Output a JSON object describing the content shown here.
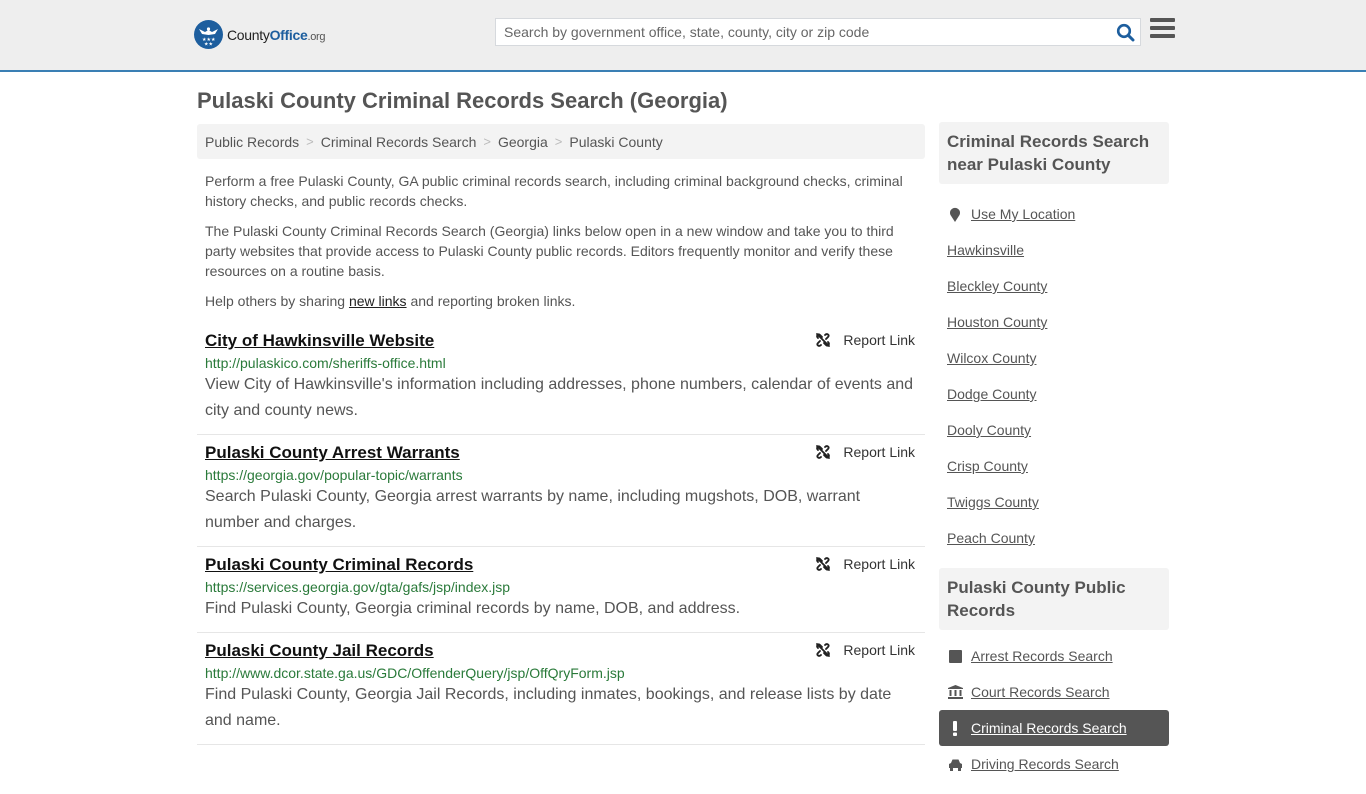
{
  "header": {
    "logo": {
      "county": "County",
      "office": "Office",
      "org": ".org"
    },
    "search_placeholder": "Search by government office, state, county, city or zip code",
    "search_value": ""
  },
  "page_title": "Pulaski County Criminal Records Search (Georgia)",
  "breadcrumb": [
    {
      "label": "Public Records"
    },
    {
      "label": "Criminal Records Search"
    },
    {
      "label": "Georgia"
    },
    {
      "label": "Pulaski County"
    }
  ],
  "breadcrumb_separator": ">",
  "intro": {
    "p1": "Perform a free Pulaski County, GA public criminal records search, including criminal background checks, criminal history checks, and public records checks.",
    "p2": "The Pulaski County Criminal Records Search (Georgia) links below open in a new window and take you to third party websites that provide access to Pulaski County public records. Editors frequently monitor and verify these resources on a routine basis.",
    "p3_before": "Help others by sharing ",
    "p3_link": "new links",
    "p3_after": " and reporting broken links."
  },
  "report_label": "Report Link",
  "results": [
    {
      "title": "City of Hawkinsville Website",
      "url": "http://pulaskico.com/sheriffs-office.html",
      "description": "View City of Hawkinsville's information including addresses, phone numbers, calendar of events and city and county news."
    },
    {
      "title": "Pulaski County Arrest Warrants",
      "url": "https://georgia.gov/popular-topic/warrants",
      "description": "Search Pulaski County, Georgia arrest warrants by name, including mugshots, DOB, warrant number and charges."
    },
    {
      "title": "Pulaski County Criminal Records",
      "url": "https://services.georgia.gov/gta/gafs/jsp/index.jsp",
      "description": "Find Pulaski County, Georgia criminal records by name, DOB, and address."
    },
    {
      "title": "Pulaski County Jail Records",
      "url": "http://www.dcor.state.ga.us/GDC/OffenderQuery/jsp/OffQryForm.jsp",
      "description": "Find Pulaski County, Georgia Jail Records, including inmates, bookings, and release lists by date and name."
    }
  ],
  "sidebar": {
    "nearby": {
      "heading": "Criminal Records Search near Pulaski County",
      "use_location": "Use My Location",
      "items": [
        "Hawkinsville",
        "Bleckley County",
        "Houston County",
        "Wilcox County",
        "Dodge County",
        "Dooly County",
        "Crisp County",
        "Twiggs County",
        "Peach County"
      ]
    },
    "public_records": {
      "heading": "Pulaski County Public Records",
      "items": [
        {
          "label": "Arrest Records Search",
          "icon": "square-icon",
          "active": false
        },
        {
          "label": "Court Records Search",
          "icon": "courthouse-icon",
          "active": false
        },
        {
          "label": "Criminal Records Search",
          "icon": "exclamation-icon",
          "active": true
        },
        {
          "label": "Driving Records Search",
          "icon": "car-icon",
          "active": false
        }
      ]
    }
  },
  "colors": {
    "accent": "#3a7fb4",
    "brand_blue": "#1d5e9e",
    "url_green": "#2a7a3a",
    "active_bg": "#555555"
  }
}
